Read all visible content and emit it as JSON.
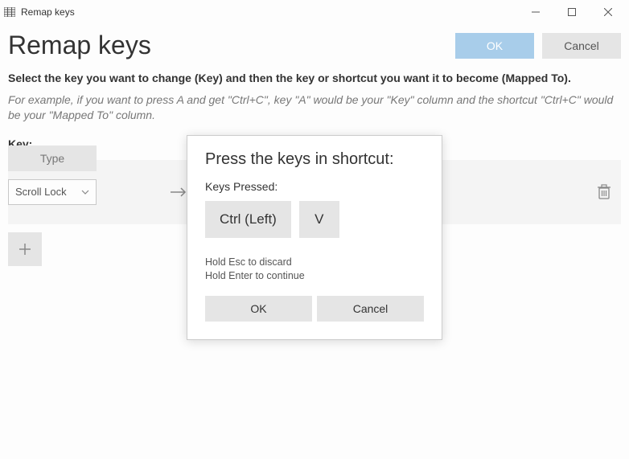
{
  "titlebar": {
    "title": "Remap keys"
  },
  "header": {
    "title": "Remap keys",
    "ok_label": "OK",
    "cancel_label": "Cancel"
  },
  "instructions": {
    "bold": "Select the key you want to change (Key) and then the key or shortcut you want it to become (Mapped To).",
    "example": "For example, if you want to press A and get \"Ctrl+C\", key \"A\" would be your \"Key\" column and the shortcut \"Ctrl+C\" would be your \"Mapped To\" column."
  },
  "columns": {
    "key_label": "Key:"
  },
  "row": {
    "type_label": "Type",
    "selected_key": "Scroll Lock"
  },
  "modal": {
    "title": "Press the keys in shortcut:",
    "keys_pressed_label": "Keys Pressed:",
    "chips": [
      "Ctrl (Left)",
      "V"
    ],
    "hint_esc": "Hold Esc to discard",
    "hint_enter": "Hold Enter to continue",
    "ok_label": "OK",
    "cancel_label": "Cancel"
  }
}
